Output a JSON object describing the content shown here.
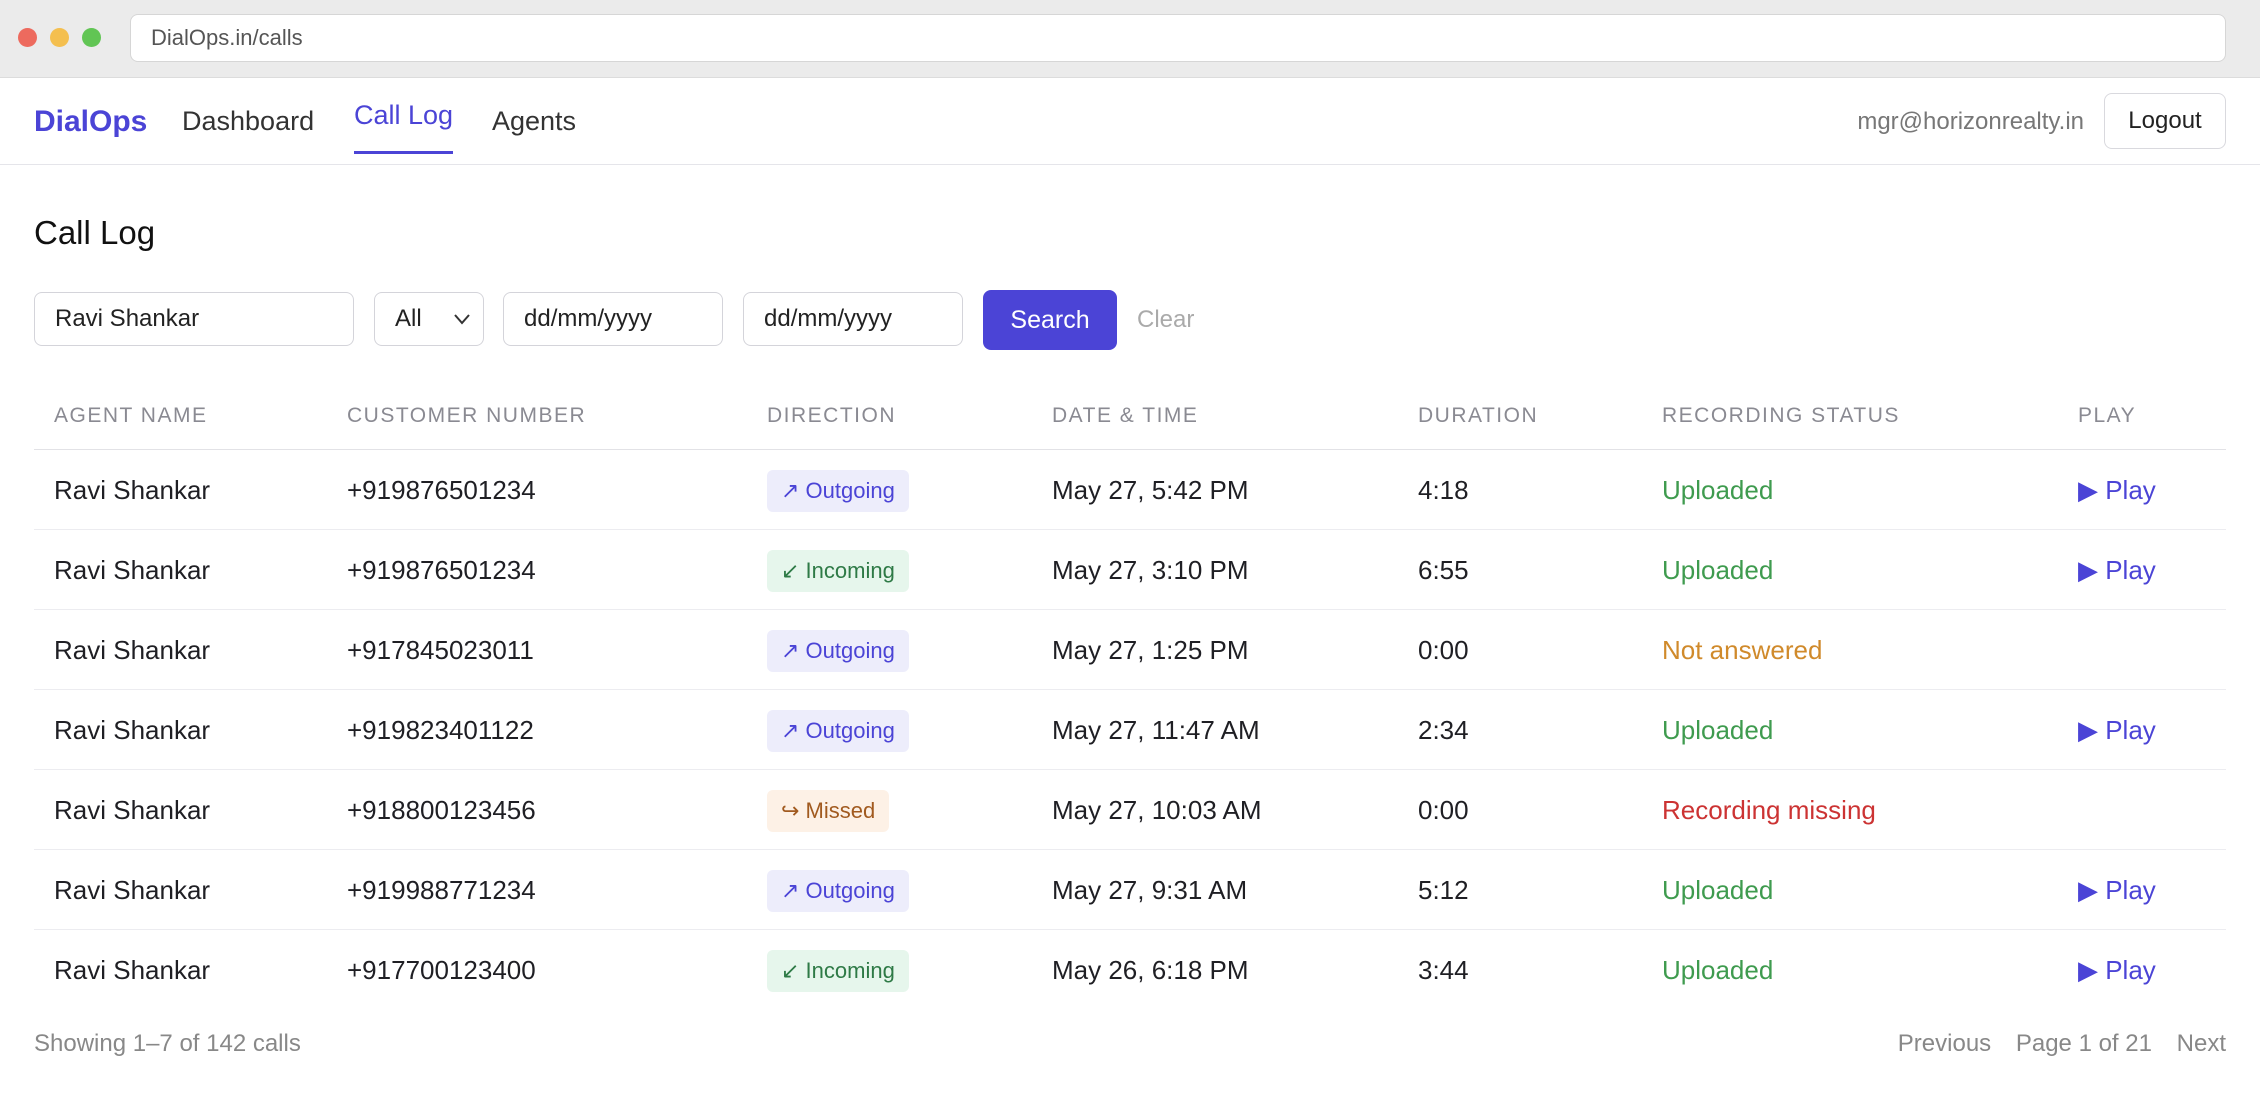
{
  "browser": {
    "url": "DialOps.in/calls"
  },
  "nav": {
    "brand": "DialOps",
    "links": [
      "Dashboard",
      "Call Log",
      "Agents"
    ],
    "user_email": "mgr@horizonrealty.in",
    "logout_label": "Logout"
  },
  "page": {
    "title": "Call Log"
  },
  "filters": {
    "search_value": "Ravi Shankar",
    "direction_value": "All",
    "from_placeholder": "dd/mm/yyyy",
    "to_placeholder": "dd/mm/yyyy",
    "search_label": "Search",
    "clear_label": "Clear"
  },
  "table": {
    "headers": [
      "AGENT NAME",
      "CUSTOMER NUMBER",
      "DIRECTION",
      "DATE & TIME",
      "DURATION",
      "RECORDING STATUS",
      "PLAY"
    ],
    "rows": [
      {
        "agent": "Ravi Shankar",
        "number": "+919876501234",
        "direction": "↗ Outgoing",
        "datetime": "May 27, 5:42 PM",
        "duration": "4:18",
        "status": "Uploaded",
        "play": "▶ Play"
      },
      {
        "agent": "Ravi Shankar",
        "number": "+919876501234",
        "direction": "↙ Incoming",
        "datetime": "May 27, 3:10 PM",
        "duration": "6:55",
        "status": "Uploaded",
        "play": "▶ Play"
      },
      {
        "agent": "Ravi Shankar",
        "number": "+917845023011",
        "direction": "↗ Outgoing",
        "datetime": "May 27, 1:25 PM",
        "duration": "0:00",
        "status": "Not answered",
        "play": ""
      },
      {
        "agent": "Ravi Shankar",
        "number": "+919823401122",
        "direction": "↗ Outgoing",
        "datetime": "May 27, 11:47 AM",
        "duration": "2:34",
        "status": "Uploaded",
        "play": "▶ Play"
      },
      {
        "agent": "Ravi Shankar",
        "number": "+918800123456",
        "direction": "↪ Missed",
        "datetime": "May 27, 10:03 AM",
        "duration": "0:00",
        "status": "Recording missing",
        "play": ""
      },
      {
        "agent": "Ravi Shankar",
        "number": "+919988771234",
        "direction": "↗ Outgoing",
        "datetime": "May 27, 9:31 AM",
        "duration": "5:12",
        "status": "Uploaded",
        "play": "▶ Play"
      },
      {
        "agent": "Ravi Shankar",
        "number": "+917700123400",
        "direction": "↙ Incoming",
        "datetime": "May 26, 6:18 PM",
        "duration": "3:44",
        "status": "Uploaded",
        "play": "▶ Play"
      }
    ]
  },
  "footer": {
    "count_text": "Showing 1–7 of 142 calls",
    "prev_label": "Previous",
    "page_text": "Page 1 of 21",
    "next_label": "Next"
  },
  "colors": {
    "accent": "#4b44d6",
    "uploaded": "#3f9b4f",
    "not_answered": "#d08a2b",
    "missing": "#cc3333"
  }
}
